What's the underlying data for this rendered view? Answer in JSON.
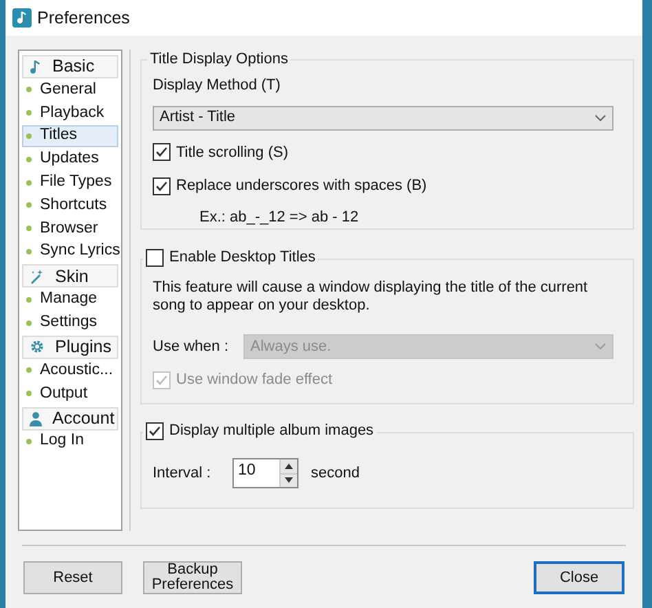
{
  "window": {
    "title": "Preferences"
  },
  "sidebar": {
    "groups": [
      {
        "kind": "note",
        "label": "Basic",
        "items": [
          {
            "label": "General",
            "selected": false
          },
          {
            "label": "Playback",
            "selected": false
          },
          {
            "label": "Titles",
            "selected": true
          },
          {
            "label": "Updates",
            "selected": false
          },
          {
            "label": "File Types",
            "selected": false
          },
          {
            "label": "Shortcuts",
            "selected": false
          },
          {
            "label": "Browser",
            "selected": false
          },
          {
            "label": "Sync Lyrics",
            "selected": false
          }
        ]
      },
      {
        "kind": "wand",
        "label": "Skin",
        "items": [
          {
            "label": "Manage",
            "selected": false
          },
          {
            "label": "Settings",
            "selected": false
          }
        ]
      },
      {
        "kind": "gear",
        "label": "Plugins",
        "items": [
          {
            "label": "Acoustic...",
            "selected": false
          },
          {
            "label": "Output",
            "selected": false
          }
        ]
      },
      {
        "kind": "person",
        "label": "Account",
        "items": [
          {
            "label": "Log In",
            "selected": false
          }
        ]
      }
    ]
  },
  "title_display": {
    "legend": "Title Display Options",
    "display_method_label": "Display Method (T)",
    "display_method_value": "Artist - Title",
    "options": [
      {
        "label": "Title scrolling (S)",
        "checked": true
      },
      {
        "label": "Replace underscores with spaces (B)",
        "checked": true
      }
    ],
    "example": "Ex.: ab_-_12 => ab - 12"
  },
  "desktop_titles": {
    "label": "Enable Desktop Titles",
    "checked": false,
    "description": "This feature will cause a window displaying the title of the current song to appear on your desktop.",
    "use_when_label": "Use when :",
    "use_when_value": "Always use.",
    "use_when_disabled": true,
    "fade": {
      "label": "Use window fade effect",
      "checked": true,
      "disabled": true
    }
  },
  "album_images": {
    "label": "Display multiple album images",
    "checked": true,
    "interval_label": "Interval :",
    "interval_value": "10",
    "unit": "second"
  },
  "buttons": [
    {
      "label": "Reset",
      "kind": "normal"
    },
    {
      "label": "Backup Preferences",
      "kind": "normal"
    },
    {
      "label": "Close",
      "kind": "default"
    }
  ]
}
